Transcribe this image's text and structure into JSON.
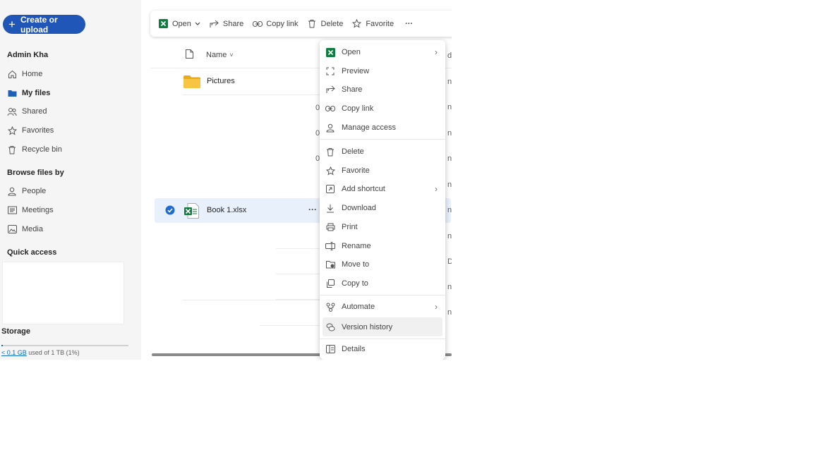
{
  "sidebar": {
    "create_label": "Create or upload",
    "user_name": "Admin Kha",
    "nav": [
      {
        "label": "Home",
        "icon": "home-icon"
      },
      {
        "label": "My files",
        "icon": "folder-icon"
      },
      {
        "label": "Shared",
        "icon": "people-icon"
      },
      {
        "label": "Favorites",
        "icon": "star-icon"
      },
      {
        "label": "Recycle bin",
        "icon": "trash-icon"
      }
    ],
    "browse_heading": "Browse files by",
    "browse": [
      {
        "label": "People",
        "icon": "person-icon"
      },
      {
        "label": "Meetings",
        "icon": "meetings-icon"
      },
      {
        "label": "Media",
        "icon": "image-icon"
      }
    ],
    "quick_access": "Quick access",
    "storage": {
      "title": "Storage",
      "used": "< 0.1 GB",
      "total_text": "used of 1 TB (1%)",
      "percent": 1
    }
  },
  "toolbar": {
    "open": "Open",
    "share": "Share",
    "copy_link": "Copy link",
    "delete": "Delete",
    "favorite": "Favorite",
    "more": "···",
    "sort_arrow": "↓"
  },
  "list": {
    "name_header": "Name",
    "sort_glyph": "˅",
    "rows": [
      {
        "name": "Pictures",
        "type": "folder"
      },
      {
        "name": "Book 1.xlsx",
        "type": "excel",
        "selected": true,
        "more": "···"
      }
    ],
    "cut_zero": "0",
    "cut_right": [
      "dif",
      "nin",
      "nin",
      "nin",
      "nin",
      "nin",
      "nin",
      "nin",
      "D",
      "nin",
      "nin"
    ]
  },
  "menu": {
    "items": [
      {
        "label": "Open",
        "icon": "excel-icon",
        "submenu": true
      },
      {
        "label": "Preview",
        "icon": "preview-icon"
      },
      {
        "label": "Share",
        "icon": "share-icon"
      },
      {
        "label": "Copy link",
        "icon": "link-icon"
      },
      {
        "label": "Manage access",
        "icon": "person-icon"
      },
      {
        "label": "Delete",
        "icon": "trash-icon"
      },
      {
        "label": "Favorite",
        "icon": "star-icon"
      },
      {
        "label": "Add shortcut",
        "icon": "shortcut-icon",
        "submenu": true
      },
      {
        "label": "Download",
        "icon": "download-icon"
      },
      {
        "label": "Print",
        "icon": "print-icon"
      },
      {
        "label": "Rename",
        "icon": "rename-icon"
      },
      {
        "label": "Move to",
        "icon": "move-icon"
      },
      {
        "label": "Copy to",
        "icon": "copy-icon"
      },
      {
        "label": "Automate",
        "icon": "automate-icon",
        "submenu": true
      },
      {
        "label": "Version history",
        "icon": "version-history-icon",
        "highlighted": true
      },
      {
        "label": "Details",
        "icon": "details-icon"
      }
    ],
    "chevron": "›"
  },
  "colors": {
    "accent": "#1f56b8",
    "excel": "#107c41",
    "folder": "#f4c137",
    "selected_row": "#e8f0fb"
  }
}
